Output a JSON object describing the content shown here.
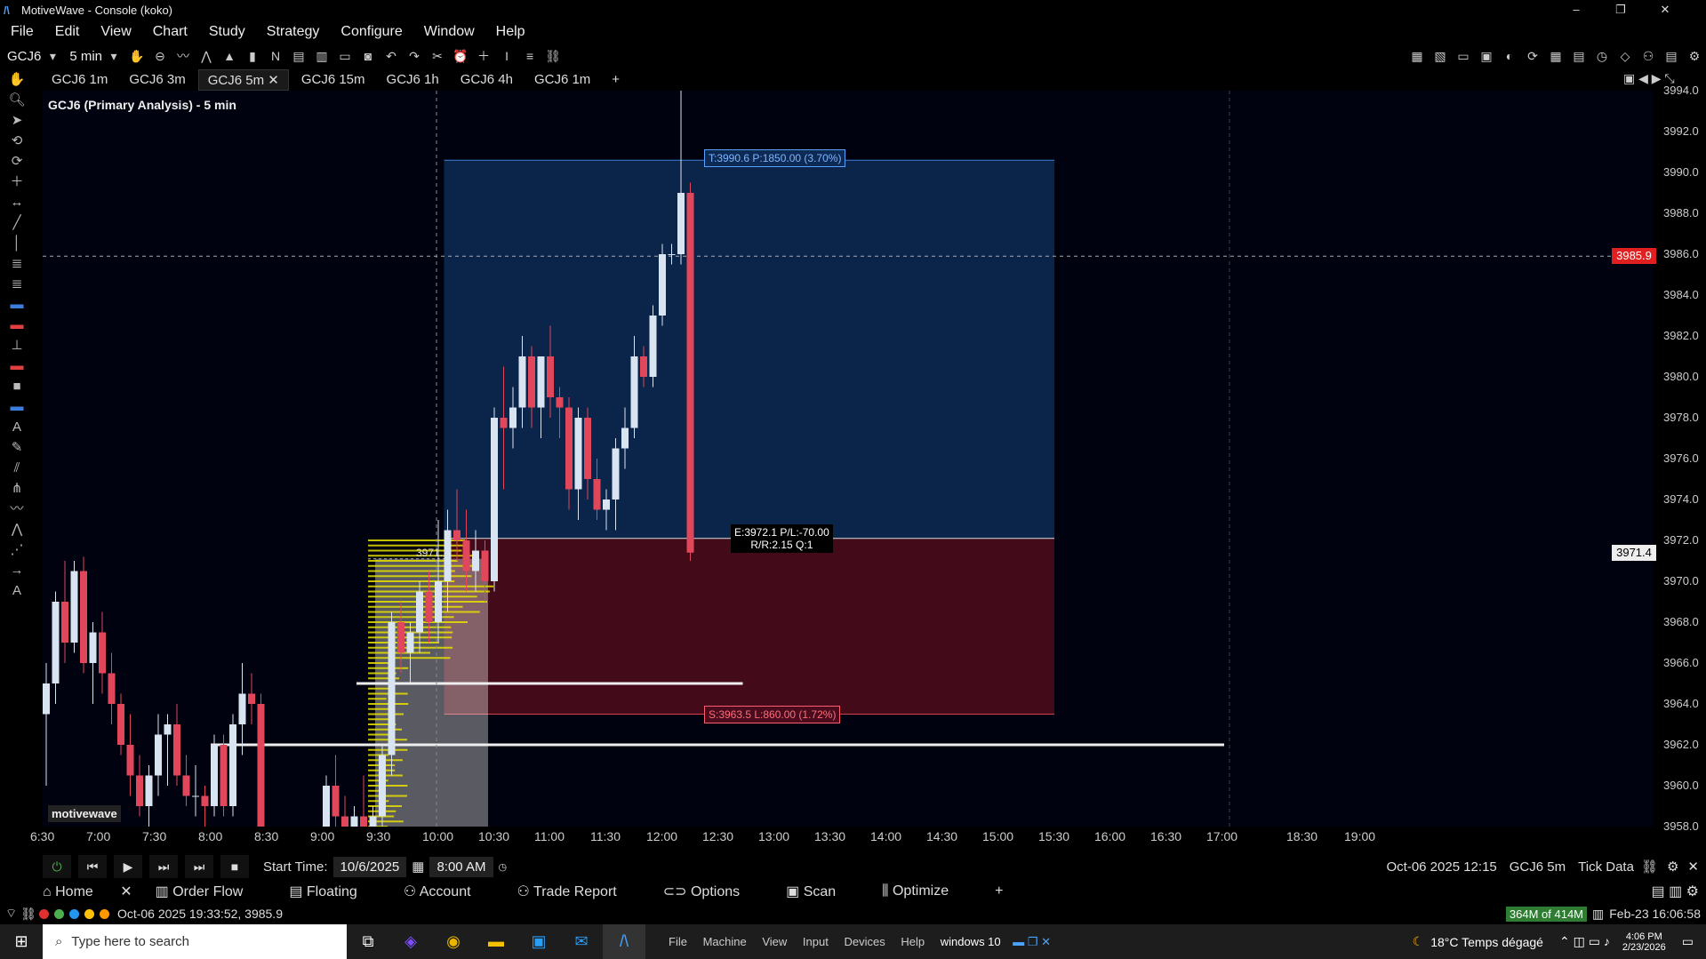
{
  "window": {
    "title": "MotiveWave - Console (koko)",
    "minimize": "–",
    "maximize": "❐",
    "close": "✕"
  },
  "menu": [
    "File",
    "Edit",
    "View",
    "Chart",
    "Study",
    "Strategy",
    "Configure",
    "Window",
    "Help"
  ],
  "toolbar": {
    "symbol": "GCJ6",
    "interval": "5 min",
    "symbol_caret": "▾",
    "interval_caret": "▾"
  },
  "tabs": [
    {
      "label": "GCJ6 1m",
      "active": false
    },
    {
      "label": "GCJ6 3m",
      "active": false
    },
    {
      "label": "GCJ6 5m",
      "active": true
    },
    {
      "label": "GCJ6 15m",
      "active": false
    },
    {
      "label": "GCJ6 1h",
      "active": false
    },
    {
      "label": "GCJ6 4h",
      "active": false
    },
    {
      "label": "GCJ6 1m",
      "active": false
    }
  ],
  "tab_add": "+",
  "tab_close": "✕",
  "chart": {
    "title": "GCJ6 (Primary Analysis) - 5 min",
    "brand": "motivewave",
    "target_label": "T:3990.6 P:1850.00 (3.70%)",
    "stop_label": "S:3963.5 L:860.00 (1.72%)",
    "entry_label1": "E:3972.1 P/L:-70.00",
    "entry_label2": "R/R:2.15 Q:1",
    "poc_label": "3971.1",
    "crosshair_price": "3985.9",
    "last_price": "3971.4",
    "target": 3990.6,
    "entry": 3972.1,
    "stop": 3963.5,
    "colors": {
      "up": "#d8e4f2",
      "down": "#e0475b",
      "target_zone": "#0d2a55",
      "stop_zone": "#4a0c1c",
      "profile": "#e8e000"
    }
  },
  "yaxis_ticks": [
    "3994.0",
    "3992.0",
    "3990.0",
    "3988.0",
    "3986.0",
    "3984.0",
    "3982.0",
    "3980.0",
    "3978.0",
    "3976.0",
    "3974.0",
    "3972.0",
    "3970.0",
    "3968.0",
    "3966.0",
    "3964.0",
    "3962.0",
    "3960.0",
    "3958.0"
  ],
  "xaxis_ticks": [
    "6:30",
    "7:00",
    "7:30",
    "8:00",
    "8:30",
    "9:00",
    "9:30",
    "10:00",
    "10:30",
    "11:00",
    "11:30",
    "12:00",
    "12:30",
    "13:00",
    "13:30",
    "14:00",
    "14:30",
    "15:00",
    "15:30",
    "16:00",
    "16:30",
    "17:00",
    "18:30",
    "19:00"
  ],
  "chart_data": {
    "type": "candlestick",
    "symbol": "GCJ6",
    "interval": "5 min",
    "ylim": [
      3958,
      3994
    ],
    "candles": [
      {
        "t": "6:30",
        "o": 3963.5,
        "h": 3966.0,
        "l": 3960.0,
        "c": 3965.0
      },
      {
        "t": "6:35",
        "o": 3965.0,
        "h": 3969.5,
        "l": 3964.0,
        "c": 3969.0
      },
      {
        "t": "6:40",
        "o": 3969.0,
        "h": 3971.0,
        "l": 3966.0,
        "c": 3967.0
      },
      {
        "t": "6:45",
        "o": 3967.0,
        "h": 3971.0,
        "l": 3966.5,
        "c": 3970.5
      },
      {
        "t": "6:50",
        "o": 3970.5,
        "h": 3971.2,
        "l": 3965.5,
        "c": 3966.0
      },
      {
        "t": "6:55",
        "o": 3966.0,
        "h": 3968.0,
        "l": 3964.0,
        "c": 3967.5
      },
      {
        "t": "7:00",
        "o": 3967.5,
        "h": 3968.5,
        "l": 3964.5,
        "c": 3965.5
      },
      {
        "t": "7:05",
        "o": 3965.5,
        "h": 3966.5,
        "l": 3963.0,
        "c": 3964.0
      },
      {
        "t": "7:10",
        "o": 3964.0,
        "h": 3964.5,
        "l": 3961.5,
        "c": 3962.0
      },
      {
        "t": "7:15",
        "o": 3962.0,
        "h": 3963.5,
        "l": 3959.5,
        "c": 3960.5
      },
      {
        "t": "7:20",
        "o": 3960.5,
        "h": 3961.5,
        "l": 3958.5,
        "c": 3959.0
      },
      {
        "t": "7:25",
        "o": 3959.0,
        "h": 3961.0,
        "l": 3958.0,
        "c": 3960.5
      },
      {
        "t": "7:30",
        "o": 3960.5,
        "h": 3963.5,
        "l": 3959.5,
        "c": 3962.5
      },
      {
        "t": "7:35",
        "o": 3962.5,
        "h": 3963.5,
        "l": 3960.0,
        "c": 3963.0
      },
      {
        "t": "7:40",
        "o": 3963.0,
        "h": 3964.0,
        "l": 3960.0,
        "c": 3960.5
      },
      {
        "t": "7:45",
        "o": 3960.5,
        "h": 3961.5,
        "l": 3959.0,
        "c": 3959.5
      },
      {
        "t": "7:50",
        "o": 3959.5,
        "h": 3961.0,
        "l": 3958.5,
        "c": 3959.5
      },
      {
        "t": "7:55",
        "o": 3959.5,
        "h": 3960.0,
        "l": 3958.0,
        "c": 3959.0
      },
      {
        "t": "8:00",
        "o": 3959.0,
        "h": 3962.5,
        "l": 3958.5,
        "c": 3962.0
      },
      {
        "t": "8:05",
        "o": 3962.0,
        "h": 3962.5,
        "l": 3958.5,
        "c": 3959.0
      },
      {
        "t": "8:10",
        "o": 3959.0,
        "h": 3963.5,
        "l": 3958.5,
        "c": 3963.0
      },
      {
        "t": "8:15",
        "o": 3963.0,
        "h": 3966.0,
        "l": 3961.5,
        "c": 3964.5
      },
      {
        "t": "8:20",
        "o": 3964.5,
        "h": 3965.5,
        "l": 3963.0,
        "c": 3964.0
      },
      {
        "t": "8:25",
        "o": 3964.0,
        "h": 3964.5,
        "l": 3957.5,
        "c": 3958.0
      },
      {
        "t": "9:00",
        "o": 3958.0,
        "h": 3960.5,
        "l": 3957.5,
        "c": 3960.0
      },
      {
        "t": "9:05",
        "o": 3960.0,
        "h": 3961.5,
        "l": 3958.0,
        "c": 3958.5
      },
      {
        "t": "9:10",
        "o": 3958.5,
        "h": 3959.5,
        "l": 3957.5,
        "c": 3958.0
      },
      {
        "t": "9:15",
        "o": 3958.0,
        "h": 3959.0,
        "l": 3957.5,
        "c": 3958.5
      },
      {
        "t": "9:20",
        "o": 3958.5,
        "h": 3960.5,
        "l": 3957.5,
        "c": 3958.0
      },
      {
        "t": "9:25",
        "o": 3958.0,
        "h": 3959.0,
        "l": 3957.5,
        "c": 3958.5
      },
      {
        "t": "9:30",
        "o": 3958.5,
        "h": 3962.0,
        "l": 3957.5,
        "c": 3961.5
      },
      {
        "t": "9:35",
        "o": 3961.5,
        "h": 3968.5,
        "l": 3960.5,
        "c": 3968.0
      },
      {
        "t": "9:40",
        "o": 3968.0,
        "h": 3969.0,
        "l": 3965.5,
        "c": 3966.5
      },
      {
        "t": "9:45",
        "o": 3966.5,
        "h": 3968.0,
        "l": 3965.0,
        "c": 3967.5
      },
      {
        "t": "9:50",
        "o": 3967.5,
        "h": 3970.0,
        "l": 3966.5,
        "c": 3969.5
      },
      {
        "t": "9:55",
        "o": 3969.5,
        "h": 3970.5,
        "l": 3967.0,
        "c": 3968.0
      },
      {
        "t": "10:00",
        "o": 3968.0,
        "h": 3973.0,
        "l": 3967.0,
        "c": 3970.0
      },
      {
        "t": "10:05",
        "o": 3970.0,
        "h": 3973.5,
        "l": 3968.5,
        "c": 3972.5
      },
      {
        "t": "10:10",
        "o": 3972.5,
        "h": 3974.5,
        "l": 3971.0,
        "c": 3972.0
      },
      {
        "t": "10:15",
        "o": 3972.0,
        "h": 3973.5,
        "l": 3969.5,
        "c": 3970.5
      },
      {
        "t": "10:20",
        "o": 3970.5,
        "h": 3972.5,
        "l": 3969.5,
        "c": 3971.5
      },
      {
        "t": "10:25",
        "o": 3971.5,
        "h": 3972.0,
        "l": 3969.0,
        "c": 3970.0
      },
      {
        "t": "10:30",
        "o": 3970.0,
        "h": 3978.5,
        "l": 3969.5,
        "c": 3978.0
      },
      {
        "t": "10:35",
        "o": 3978.0,
        "h": 3980.5,
        "l": 3974.5,
        "c": 3977.5
      },
      {
        "t": "10:40",
        "o": 3977.5,
        "h": 3979.5,
        "l": 3976.5,
        "c": 3978.5
      },
      {
        "t": "10:45",
        "o": 3978.5,
        "h": 3982.0,
        "l": 3977.5,
        "c": 3981.0
      },
      {
        "t": "10:50",
        "o": 3981.0,
        "h": 3981.5,
        "l": 3977.5,
        "c": 3978.5
      },
      {
        "t": "10:55",
        "o": 3978.5,
        "h": 3981.0,
        "l": 3977.0,
        "c": 3981.0
      },
      {
        "t": "11:00",
        "o": 3981.0,
        "h": 3982.5,
        "l": 3978.0,
        "c": 3979.0
      },
      {
        "t": "11:05",
        "o": 3979.0,
        "h": 3979.5,
        "l": 3977.0,
        "c": 3978.5
      },
      {
        "t": "11:10",
        "o": 3978.5,
        "h": 3979.0,
        "l": 3973.5,
        "c": 3974.5
      },
      {
        "t": "11:15",
        "o": 3974.5,
        "h": 3978.5,
        "l": 3973.0,
        "c": 3978.0
      },
      {
        "t": "11:20",
        "o": 3978.0,
        "h": 3978.5,
        "l": 3974.0,
        "c": 3975.0
      },
      {
        "t": "11:25",
        "o": 3975.0,
        "h": 3976.0,
        "l": 3973.0,
        "c": 3973.5
      },
      {
        "t": "11:30",
        "o": 3973.5,
        "h": 3974.5,
        "l": 3972.5,
        "c": 3974.0
      },
      {
        "t": "11:35",
        "o": 3974.0,
        "h": 3977.0,
        "l": 3972.5,
        "c": 3976.5
      },
      {
        "t": "11:40",
        "o": 3976.5,
        "h": 3978.5,
        "l": 3975.5,
        "c": 3977.5
      },
      {
        "t": "11:45",
        "o": 3977.5,
        "h": 3982.0,
        "l": 3977.0,
        "c": 3981.0
      },
      {
        "t": "11:50",
        "o": 3981.0,
        "h": 3981.5,
        "l": 3979.5,
        "c": 3980.0
      },
      {
        "t": "11:55",
        "o": 3980.0,
        "h": 3983.5,
        "l": 3979.5,
        "c": 3983.0
      },
      {
        "t": "12:00",
        "o": 3983.0,
        "h": 3986.5,
        "l": 3982.5,
        "c": 3986.0
      },
      {
        "t": "12:05",
        "o": 3986.0,
        "h": 3986.5,
        "l": 3985.5,
        "c": 3986.0
      },
      {
        "t": "12:10",
        "o": 3986.0,
        "h": 3994.0,
        "l": 3985.5,
        "c": 3989.0
      },
      {
        "t": "12:15",
        "o": 3989.0,
        "h": 3989.5,
        "l": 3971.0,
        "c": 3971.4
      }
    ],
    "volume_profile_poc": 3971.1,
    "horizontal_lines": [
      3965.0,
      3962.0
    ],
    "crosshair_price": 3985.9,
    "last_price": 3971.4
  },
  "replay": {
    "start_label": "Start Time:",
    "date": "10/6/2025",
    "time": "8:00 AM",
    "current": "Oct-06 2025 12:15",
    "symbol": "GCJ6 5m",
    "mode": "Tick Data"
  },
  "bottom_tabs": [
    "Home",
    "Order Flow",
    "Floating",
    "Account",
    "Trade Report",
    "Options",
    "Scan",
    "Optimize"
  ],
  "status": {
    "text": "Oct-06 2025 19:33:52, 3985.9",
    "memory": "364M of 414M",
    "datetime": "Feb-23 16:06:58"
  },
  "taskbar": {
    "search": "Type here to search",
    "weather": "18°C  Temps dégagé",
    "time": "4:06 PM",
    "date": "2/23/2026",
    "app_menu": [
      "File",
      "Machine",
      "View",
      "Input",
      "Devices",
      "Help"
    ],
    "vm": "windows 10"
  }
}
